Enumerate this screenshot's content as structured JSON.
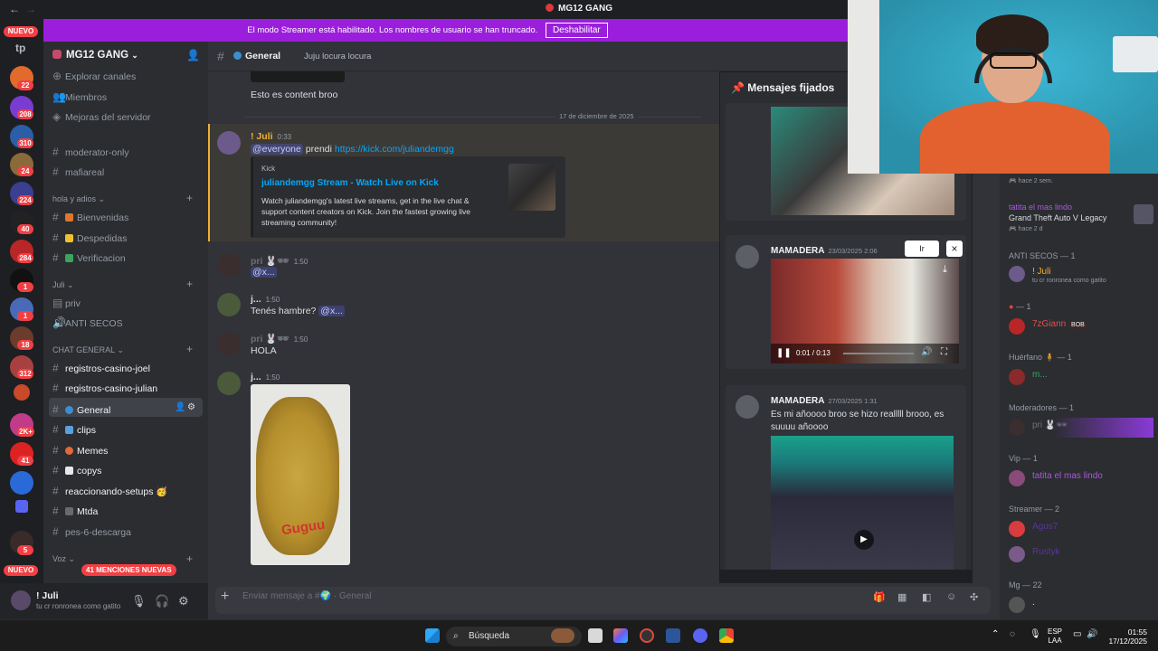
{
  "titlebar": {
    "title": "MG12 GANG",
    "back": "←",
    "forward": "→"
  },
  "banner": {
    "text": "El modo Streamer está habilitado. Los nombres de usuario se han truncado.",
    "button": "Deshabilitar"
  },
  "rail": {
    "nuevo_top": "NUEVO",
    "nuevo_bottom": "NUEVO",
    "tp": "tp",
    "badges": [
      "22",
      "208",
      "310",
      "24",
      "224",
      "40",
      "284",
      "1",
      "1",
      "18",
      "312",
      "2K+",
      "41",
      "5"
    ]
  },
  "server": {
    "name": "MG12 GANG"
  },
  "channels": {
    "explore": "Explorar canales",
    "members": "Miembros",
    "boosts": "Mejoras del servidor",
    "moderator_only": "moderator-only",
    "mafiareal": "mafiareal",
    "cat_hola": "hola y adios",
    "bienvenidas": "Bienvenidas",
    "despedidas": "Despedidas",
    "verificacion": "Verificacion",
    "cat_juli": "Juli",
    "priv": "priv",
    "anti_secos": "ANTI SECOS",
    "cat_chat": "CHAT GENERAL",
    "reg_joel": "registros-casino-joel",
    "reg_julian": "registros-casino-julian",
    "general": "General",
    "clips": "clips",
    "memes": "Memes",
    "copys": "copys",
    "reaccionando": "reaccionando-setups 🥳",
    "mtda": "Mtda",
    "pes": "pes-6-descarga",
    "cat_voz": "Voz",
    "mentions": "41 MENCIONES NUEVAS"
  },
  "user": {
    "name": "! Juli",
    "status": "tu cr ronronea como gatito"
  },
  "chat_header": {
    "channel": "General",
    "topic": "Juju locura locura"
  },
  "messages": {
    "m0_text": "Esto es content broo",
    "date": "17 de diciembre de 2025",
    "m1_author": "! Juli",
    "m1_time": "0:33",
    "m1_mention": "@everyone",
    "m1_text": " prendi ",
    "m1_link": "https://kick.com/juliandemgg",
    "embed_provider": "Kick",
    "embed_title": "juliandemgg Stream - Watch Live on Kick",
    "embed_desc": "Watch juliandemgg's latest live streams, get in the live chat & support content creators on Kick. Join the fastest growing live streaming community!",
    "m2_author": "pri 🐰🕶",
    "m2_time": "1:50",
    "m2_text": "@x...",
    "m3_author": "j...",
    "m3_time": "1:50",
    "m3_text": "Tenés hambre? ",
    "m3_mention": "@x...",
    "m4_author": "pri 🐰🕶",
    "m4_time": "1:50",
    "m4_text": "HOLA",
    "m5_author": "j...",
    "m5_time": "1:50",
    "m5_image_caption": "Guguu"
  },
  "pinned": {
    "title": "Mensajes fijados",
    "p1_author": "MAMADERA",
    "p1_date": "23/03/2025 2:06",
    "p1_goto": "Ir",
    "p1_close": "×",
    "p1_video_time": "0:01 / 0:13",
    "p2_author": "MAMADERA",
    "p2_date": "27/03/2025 1:31",
    "p2_text": "Es mi añoooo broo se hizo realllll brooo, es suuuu añoooo"
  },
  "members": {
    "activity1_time": "hace 2 sem.",
    "activity2_name": "tatita el mas lindo",
    "activity2_game": "Grand Theft Auto V Legacy",
    "activity2_time": "hace 2 d",
    "cat_anti": "ANTI SECOS — 1",
    "anti_name": "! Juli",
    "anti_status": "tu cr ronronea como gatito",
    "cat_drop": "— 1",
    "drop_name": "7zGiann",
    "drop_tag": "BOB",
    "cat_huerfano": "Huérfano 🧍 — 1",
    "huerfano_name": "m...",
    "cat_mod": "Moderadores — 1",
    "mod_name": "pri 🐰🕶",
    "cat_vip": "Vip — 1",
    "vip_name": "tatita el mas lindo",
    "cat_streamer": "Streamer — 2",
    "streamer1": "Agus7",
    "streamer2": "Rustyk",
    "cat_mg": "Mg — 22",
    "mg1": "."
  },
  "composer": {
    "placeholder": "Enviar mensaje a #🌍 · General"
  },
  "taskbar": {
    "search": "Búsqueda",
    "lang1": "ESP",
    "lang2": "LAA",
    "time": "01:55",
    "date": "17/12/2025"
  },
  "colors": {
    "accent": "#5865f2",
    "streamer": "#9b1edc",
    "mention_red": "#f23f43",
    "link": "#00a8fc"
  }
}
